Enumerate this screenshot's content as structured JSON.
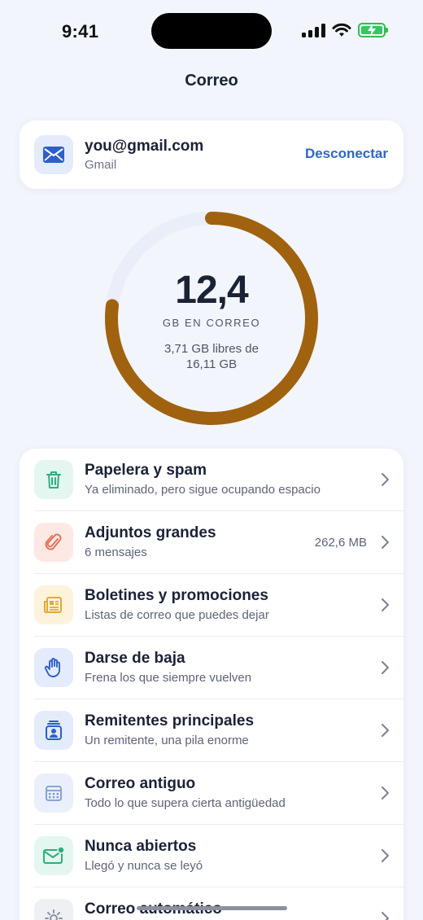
{
  "status_bar": {
    "time": "9:41"
  },
  "page": {
    "title": "Correo"
  },
  "account": {
    "email": "you@gmail.com",
    "provider": "Gmail",
    "disconnect_label": "Desconectar",
    "icon": "mail-icon"
  },
  "storage": {
    "used_value": "12,4",
    "used_label": "GB EN CORREO",
    "free_text": "3,71 GB libres de 16,11 GB",
    "used_fraction": 0.77,
    "ring_color": "#a0620f",
    "track_color": "#e9eef9"
  },
  "categories": [
    {
      "title": "Papelera y spam",
      "subtitle": "Ya eliminado, pero sigue ocupando espacio",
      "value": "",
      "icon": "trash-icon",
      "color": "#e3f6ef"
    },
    {
      "title": "Adjuntos grandes",
      "subtitle": "6 mensajes",
      "value": "262,6 MB",
      "icon": "paperclip-icon",
      "color": "#fde8e4"
    },
    {
      "title": "Boletines y promociones",
      "subtitle": "Listas de correo que puedes dejar",
      "value": "",
      "icon": "newsletter-icon",
      "color": "#fdf3dc"
    },
    {
      "title": "Darse de baja",
      "subtitle": "Frena los que siempre vuelven",
      "value": "",
      "icon": "hand-icon",
      "color": "#e4ebfb"
    },
    {
      "title": "Remitentes principales",
      "subtitle": "Un remitente, una pila enorme",
      "value": "",
      "icon": "contact-stack-icon",
      "color": "#e4ebfb"
    },
    {
      "title": "Correo antiguo",
      "subtitle": "Todo lo que supera cierta antigüedad",
      "value": "",
      "icon": "calendar-icon",
      "color": "#eaeffb"
    },
    {
      "title": "Nunca abiertos",
      "subtitle": "Llegó y nunca se leyó",
      "value": "",
      "icon": "unread-mail-icon",
      "color": "#e3f6ef"
    },
    {
      "title": "Correo automático",
      "subtitle": "",
      "value": "",
      "icon": "gear-icon",
      "color": "#eef0f4"
    }
  ]
}
